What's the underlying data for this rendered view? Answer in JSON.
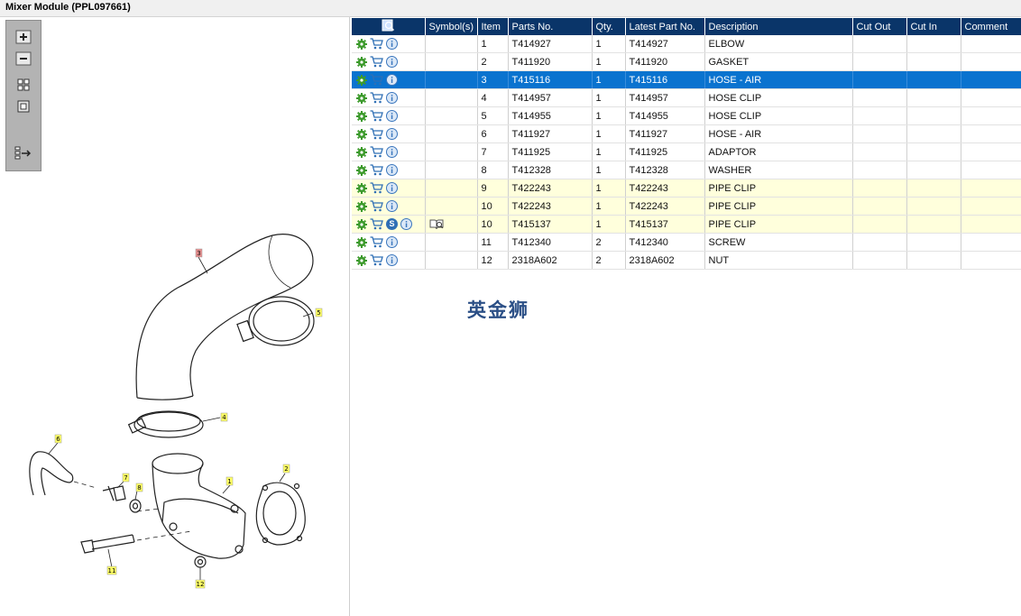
{
  "window": {
    "title": "Mixer Module (PPL097661)"
  },
  "toolbar": {
    "buttons": [
      {
        "name": "zoom-in",
        "icon": "plus-icon"
      },
      {
        "name": "zoom-out",
        "icon": "minus-icon"
      },
      {
        "name": "fit-all",
        "icon": "grid-icon"
      },
      {
        "name": "fit-window",
        "icon": "square-icon"
      },
      {
        "name": "split-view",
        "icon": "list-arrow-icon"
      }
    ]
  },
  "diagram": {
    "callouts": [
      {
        "label": "3",
        "highlight": "red"
      },
      {
        "label": "5",
        "highlight": "yellow"
      },
      {
        "label": "4",
        "highlight": "yellow"
      },
      {
        "label": "6",
        "highlight": "yellow"
      },
      {
        "label": "2",
        "highlight": "yellow"
      },
      {
        "label": "7",
        "highlight": "yellow"
      },
      {
        "label": "8",
        "highlight": "yellow"
      },
      {
        "label": "1",
        "highlight": "yellow"
      },
      {
        "label": "11",
        "highlight": "yellow"
      },
      {
        "label": "12",
        "highlight": "yellow"
      }
    ]
  },
  "table": {
    "columns": [
      "",
      "Symbol(s)",
      "Item",
      "Parts No.",
      "Qty.",
      "Latest Part No.",
      "Description",
      "Cut Out",
      "Cut In",
      "Comment"
    ],
    "rows": [
      {
        "item": "1",
        "part": "T414927",
        "qty": "1",
        "latest": "T414927",
        "desc": "ELBOW",
        "state": ""
      },
      {
        "item": "2",
        "part": "T411920",
        "qty": "1",
        "latest": "T411920",
        "desc": "GASKET",
        "state": ""
      },
      {
        "item": "3",
        "part": "T415116",
        "qty": "1",
        "latest": "T415116",
        "desc": "HOSE - AIR",
        "state": "selected"
      },
      {
        "item": "4",
        "part": "T414957",
        "qty": "1",
        "latest": "T414957",
        "desc": "HOSE CLIP",
        "state": ""
      },
      {
        "item": "5",
        "part": "T414955",
        "qty": "1",
        "latest": "T414955",
        "desc": "HOSE CLIP",
        "state": ""
      },
      {
        "item": "6",
        "part": "T411927",
        "qty": "1",
        "latest": "T411927",
        "desc": "HOSE - AIR",
        "state": ""
      },
      {
        "item": "7",
        "part": "T411925",
        "qty": "1",
        "latest": "T411925",
        "desc": "ADAPTOR",
        "state": ""
      },
      {
        "item": "8",
        "part": "T412328",
        "qty": "1",
        "latest": "T412328",
        "desc": "WASHER",
        "state": ""
      },
      {
        "item": "9",
        "part": "T422243",
        "qty": "1",
        "latest": "T422243",
        "desc": "PIPE CLIP",
        "state": "highlight"
      },
      {
        "item": "10",
        "part": "T422243",
        "qty": "1",
        "latest": "T422243",
        "desc": "PIPE CLIP",
        "state": "highlight"
      },
      {
        "item": "10",
        "part": "T415137",
        "qty": "1",
        "latest": "T415137",
        "desc": "PIPE CLIP",
        "state": "highlight",
        "service": "S",
        "symbol": "book-icon"
      },
      {
        "item": "11",
        "part": "T412340",
        "qty": "2",
        "latest": "T412340",
        "desc": "SCREW",
        "state": ""
      },
      {
        "item": "12",
        "part": "2318A602",
        "qty": "2",
        "latest": "2318A602",
        "desc": "NUT",
        "state": ""
      }
    ]
  },
  "watermark": "英金狮",
  "colors": {
    "header": "#0a3569",
    "selected": "#0a73cf",
    "highlight": "#ffffdc"
  }
}
